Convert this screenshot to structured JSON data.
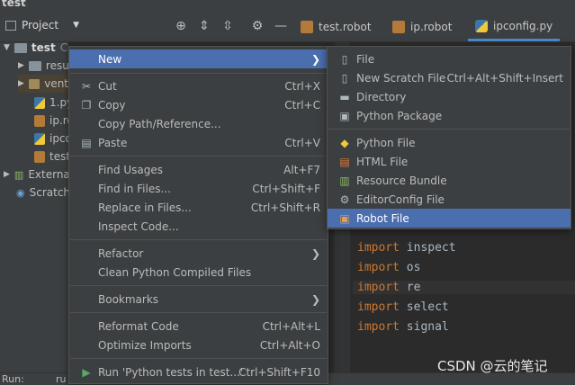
{
  "window": {
    "title": "test"
  },
  "toolbar": {
    "project_label": "Project",
    "tabs": [
      {
        "label": "test.robot",
        "type": "robot"
      },
      {
        "label": "ip.robot",
        "type": "robot"
      },
      {
        "label": "ipconfig.py",
        "type": "python"
      }
    ]
  },
  "tree": {
    "root": "test",
    "root_path": "C",
    "items": [
      "resu",
      "vent",
      "1.py",
      "ip.ro",
      "ipco",
      "test",
      "Externa",
      "Scratch"
    ]
  },
  "context_menu": {
    "items": [
      {
        "label": "New",
        "shortcut": "",
        "icon": "",
        "has_submenu": true
      },
      {
        "label": "Cut",
        "shortcut": "Ctrl+X",
        "icon": "scissors-icon"
      },
      {
        "label": "Copy",
        "shortcut": "Ctrl+C",
        "icon": "copy-icon"
      },
      {
        "label": "Copy Path/Reference...",
        "shortcut": "",
        "icon": ""
      },
      {
        "label": "Paste",
        "shortcut": "Ctrl+V",
        "icon": "paste-icon"
      },
      {
        "label": "Find Usages",
        "shortcut": "Alt+F7",
        "icon": ""
      },
      {
        "label": "Find in Files...",
        "shortcut": "Ctrl+Shift+F",
        "icon": ""
      },
      {
        "label": "Replace in Files...",
        "shortcut": "Ctrl+Shift+R",
        "icon": ""
      },
      {
        "label": "Inspect Code...",
        "shortcut": "",
        "icon": ""
      },
      {
        "label": "Refactor",
        "shortcut": "",
        "icon": "",
        "has_submenu": true
      },
      {
        "label": "Clean Python Compiled Files",
        "shortcut": "",
        "icon": ""
      },
      {
        "label": "Bookmarks",
        "shortcut": "",
        "icon": "",
        "has_submenu": true
      },
      {
        "label": "Reformat Code",
        "shortcut": "Ctrl+Alt+L",
        "icon": ""
      },
      {
        "label": "Optimize Imports",
        "shortcut": "Ctrl+Alt+O",
        "icon": ""
      },
      {
        "label": "Run 'Python tests in test...'",
        "shortcut": "Ctrl+Shift+F10",
        "icon": "run-icon"
      }
    ]
  },
  "new_submenu": {
    "items": [
      {
        "label": "File",
        "shortcut": "",
        "icon": "file-icon"
      },
      {
        "label": "New Scratch File",
        "shortcut": "Ctrl+Alt+Shift+Insert",
        "icon": "scratch-file-icon"
      },
      {
        "label": "Directory",
        "shortcut": "",
        "icon": "folder-icon"
      },
      {
        "label": "Python Package",
        "shortcut": "",
        "icon": "package-icon"
      },
      {
        "label": "Python File",
        "shortcut": "",
        "icon": "python-icon"
      },
      {
        "label": "HTML File",
        "shortcut": "",
        "icon": "html-icon"
      },
      {
        "label": "Resource Bundle",
        "shortcut": "",
        "icon": "resource-bundle-icon"
      },
      {
        "label": "EditorConfig File",
        "shortcut": "",
        "icon": "gear-icon"
      },
      {
        "label": "Robot File",
        "shortcut": "",
        "icon": "robot-icon"
      }
    ]
  },
  "editor": {
    "lines": [
      {
        "kw": "import",
        "id": "inspect"
      },
      {
        "kw": "import",
        "id": "os"
      },
      {
        "kw": "import",
        "id": "re"
      },
      {
        "kw": "import",
        "id": "select"
      },
      {
        "kw": "import",
        "id": "signal"
      }
    ]
  },
  "statusbar": {
    "left": "Run:",
    "sub": "ru"
  },
  "watermark": "CSDN @云的笔记"
}
